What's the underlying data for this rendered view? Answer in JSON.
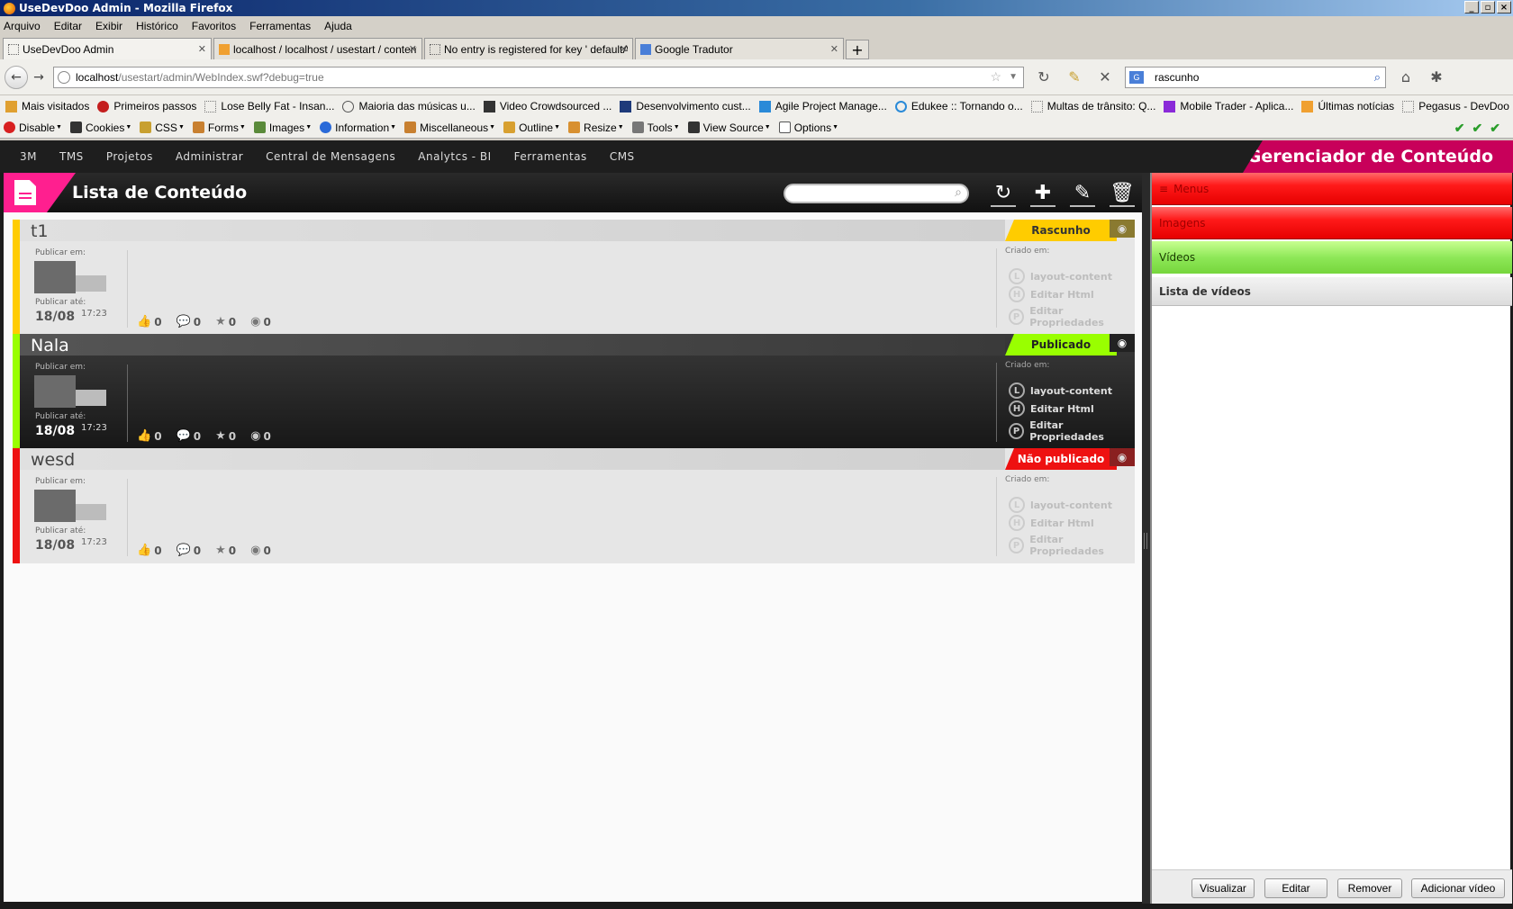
{
  "window": {
    "title": "UseDevDoo Admin - Mozilla Firefox"
  },
  "menu": [
    "Arquivo",
    "Editar",
    "Exibir",
    "Histórico",
    "Favoritos",
    "Ferramentas",
    "Ajuda"
  ],
  "tabs": [
    {
      "label": "UseDevDoo Admin",
      "active": true
    },
    {
      "label": "localhost / localhost / usestart / content |...",
      "active": false
    },
    {
      "label": "No entry is registered for key ' defaultAd...",
      "active": false
    },
    {
      "label": "Google Tradutor",
      "active": false
    }
  ],
  "url": {
    "host": "localhost",
    "path": "/usestart/admin/WebIndex.swf?debug=true"
  },
  "search": {
    "value": "rascunho"
  },
  "bookmarks": [
    "Mais visitados",
    "Primeiros passos",
    "Lose Belly Fat - Insan...",
    "Maioria das músicas u...",
    "Video Crowdsourced ...",
    "Desenvolvimento cust...",
    "Agile Project Manage...",
    "Edukee :: Tornando o...",
    "Multas de trânsito: Q...",
    "Mobile Trader - Aplica...",
    "Últimas notícias",
    "Pegasus - DevDoo"
  ],
  "devtools": [
    "Disable",
    "Cookies",
    "CSS",
    "Forms",
    "Images",
    "Information",
    "Miscellaneous",
    "Outline",
    "Resize",
    "Tools",
    "View Source",
    "Options"
  ],
  "app": {
    "nav": [
      "3M",
      "TMS",
      "Projetos",
      "Administrar",
      "Central de Mensagens",
      "Analytcs - BI",
      "Ferramentas",
      "CMS"
    ],
    "brand": "Gerenciador de Conteúdo",
    "list_title": "Lista de Conteúdo",
    "labels": {
      "publicar_em": "Publicar em:",
      "publicar_ate": "Publicar até:",
      "criado_em": "Criado em:",
      "action_layout": "layout-content",
      "action_html": "Editar Html",
      "action_props": "Editar Propriedades"
    },
    "items": [
      {
        "name": "t1",
        "status": "Rascunho",
        "status_color": "#ffcc00",
        "date": "18/08",
        "time": "17:23",
        "likes": "0",
        "comments": "0",
        "stars": "0",
        "views": "0"
      },
      {
        "name": "Nala",
        "status": "Publicado",
        "status_color": "#99ff00",
        "date": "18/08",
        "time": "17:23",
        "likes": "0",
        "comments": "0",
        "stars": "0",
        "views": "0"
      },
      {
        "name": "wesd",
        "status": "Não publicado",
        "status_color": "#ee1111",
        "date": "18/08",
        "time": "17:23",
        "likes": "0",
        "comments": "0",
        "stars": "0",
        "views": "0"
      }
    ]
  },
  "right_panel": {
    "menu_items": [
      {
        "label": "Menus",
        "style": "red"
      },
      {
        "label": "Imagens",
        "style": "red"
      },
      {
        "label": "Vídeos",
        "style": "green"
      }
    ],
    "list_title": "Lista de vídeos",
    "buttons": [
      "Visualizar",
      "Editar",
      "Remover",
      "Adicionar vídeo"
    ]
  }
}
